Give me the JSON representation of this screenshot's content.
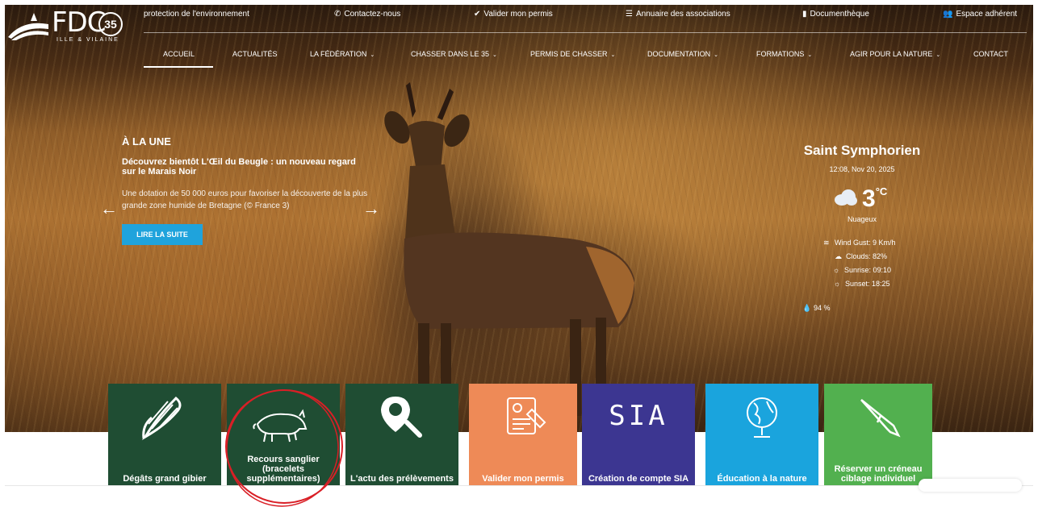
{
  "logo": {
    "text": "FDC",
    "number": "35",
    "subtitle": "ILLE & VILAINE"
  },
  "topbar": {
    "items": [
      {
        "label": "protection de l'environnement",
        "icon": ""
      },
      {
        "label": "Contactez-nous",
        "icon": "phone-icon"
      },
      {
        "label": "Valider mon permis",
        "icon": "check-circle-icon"
      },
      {
        "label": "Annuaire des associations",
        "icon": "list-icon"
      },
      {
        "label": "Documenthèque",
        "icon": "document-icon"
      },
      {
        "label": "Espace adhérent",
        "icon": "users-icon"
      }
    ]
  },
  "nav": {
    "items": [
      {
        "label": "ACCUEIL",
        "dropdown": false,
        "active": true
      },
      {
        "label": "ACTUALITÉS",
        "dropdown": false
      },
      {
        "label": "LA FÉDÉRATION",
        "dropdown": true
      },
      {
        "label": "CHASSER DANS LE 35",
        "dropdown": true
      },
      {
        "label": "PERMIS DE CHASSER",
        "dropdown": true
      },
      {
        "label": "DOCUMENTATION",
        "dropdown": true
      },
      {
        "label": "FORMATIONS",
        "dropdown": true
      },
      {
        "label": "AGIR POUR LA NATURE",
        "dropdown": true
      },
      {
        "label": "CONTACT",
        "dropdown": false
      }
    ],
    "chevron": "⌄"
  },
  "slider": {
    "kicker": "À LA UNE",
    "title": "Découvrez bientôt L'Œil du Beugle : un nouveau regard sur le Marais Noir",
    "description": "Une dotation de 50 000 euros pour favoriser la découverte de la plus grande zone humide de Bretagne (© France 3)",
    "button": "LIRE LA SUITE",
    "prev": "←",
    "next": "→"
  },
  "weather": {
    "city": "Saint Symphorien",
    "datetime": "12:08, Nov 20, 2025",
    "temp": "3",
    "unit": "°C",
    "condition": "Nuageux",
    "wind": "Wind Gust: 9 Km/h",
    "clouds": "Clouds: 82%",
    "sunrise": "Sunrise: 09:10",
    "sunset": "Sunset: 18:25",
    "humidity": "94 %"
  },
  "tiles": [
    {
      "label": "Dégâts grand gibier",
      "icon": "corn-icon",
      "color": "#1f4d33"
    },
    {
      "label": "Recours sanglier (bracelets supplémentaires)",
      "icon": "boar-icon",
      "color": "#1f4d33"
    },
    {
      "label": "L'actu des prélèvements",
      "icon": "location-search-icon",
      "color": "#1f4d33"
    },
    {
      "label": "Valider mon permis",
      "icon": "permit-icon",
      "color": "#ee8a57"
    },
    {
      "label": "Création de compte SIA",
      "icon": "sia-icon",
      "color": "#3c3691",
      "icon_text": "SIA"
    },
    {
      "label": "Éducation à la nature",
      "icon": "globe-icon",
      "color": "#1aa4dd"
    },
    {
      "label": "Réserver un créneau ciblage individuel",
      "icon": "rifle-icon",
      "color": "#52b04f"
    }
  ]
}
